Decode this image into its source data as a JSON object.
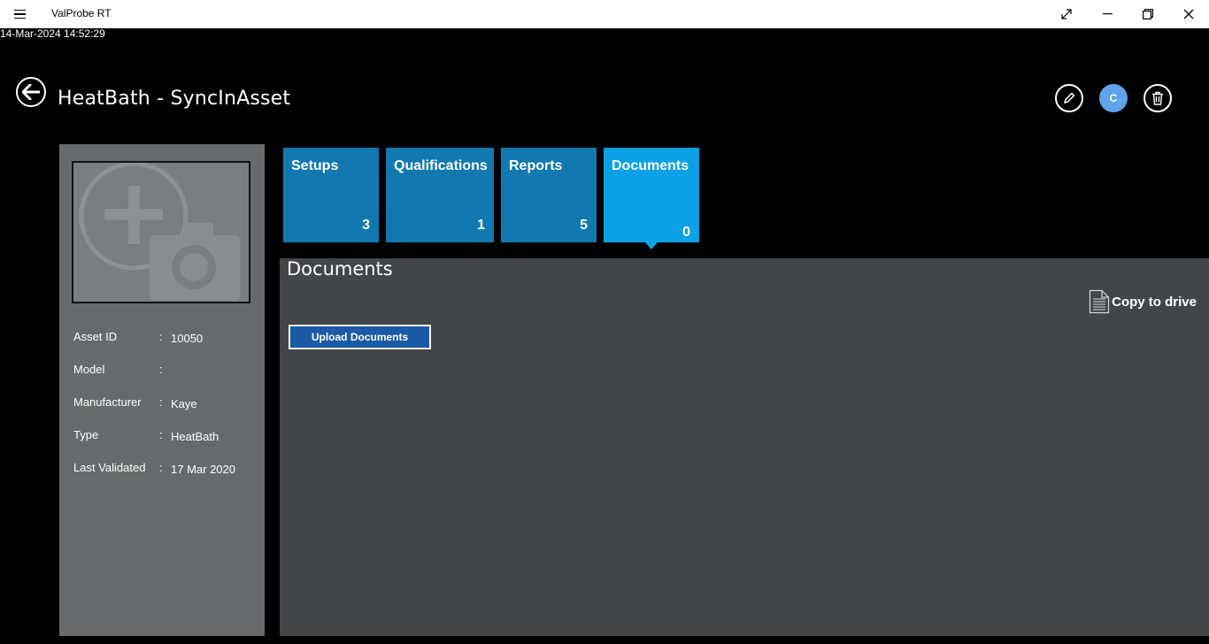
{
  "window": {
    "app_title": "ValProbe RT",
    "icons": [
      "hamburger-menu-icon",
      "fullscreen-icon",
      "minimize-icon",
      "restore-icon",
      "close-icon"
    ]
  },
  "timestamp": "14-Mar-2024 14:52:29",
  "header": {
    "title": "HeatBath - SyncInAsset",
    "avatar_letter": "C"
  },
  "asset": {
    "fields": [
      {
        "label": "Asset ID",
        "value": "10050"
      },
      {
        "label": "Model",
        "value": ""
      },
      {
        "label": "Manufacturer",
        "value": "Kaye"
      },
      {
        "label": "Type",
        "value": "HeatBath"
      },
      {
        "label": "Last Validated",
        "value": "17 Mar 2020"
      }
    ],
    "separator": ":"
  },
  "tiles": [
    {
      "label": "Setups",
      "count": "3"
    },
    {
      "label": "Qualifications",
      "count": "1"
    },
    {
      "label": "Reports",
      "count": "5"
    },
    {
      "label": "Documents",
      "count": "0",
      "active": true
    }
  ],
  "content": {
    "section_title": "Documents",
    "copy_to_drive": "Copy to drive",
    "upload_button": "Upload Documents"
  },
  "colors": {
    "tile": "#1279b0",
    "tile_active": "#0ba1e6",
    "panel_left": "#676a6c",
    "panel_content": "#434649",
    "upload_button": "#1a5aa6",
    "avatar": "#5fa3ea"
  }
}
